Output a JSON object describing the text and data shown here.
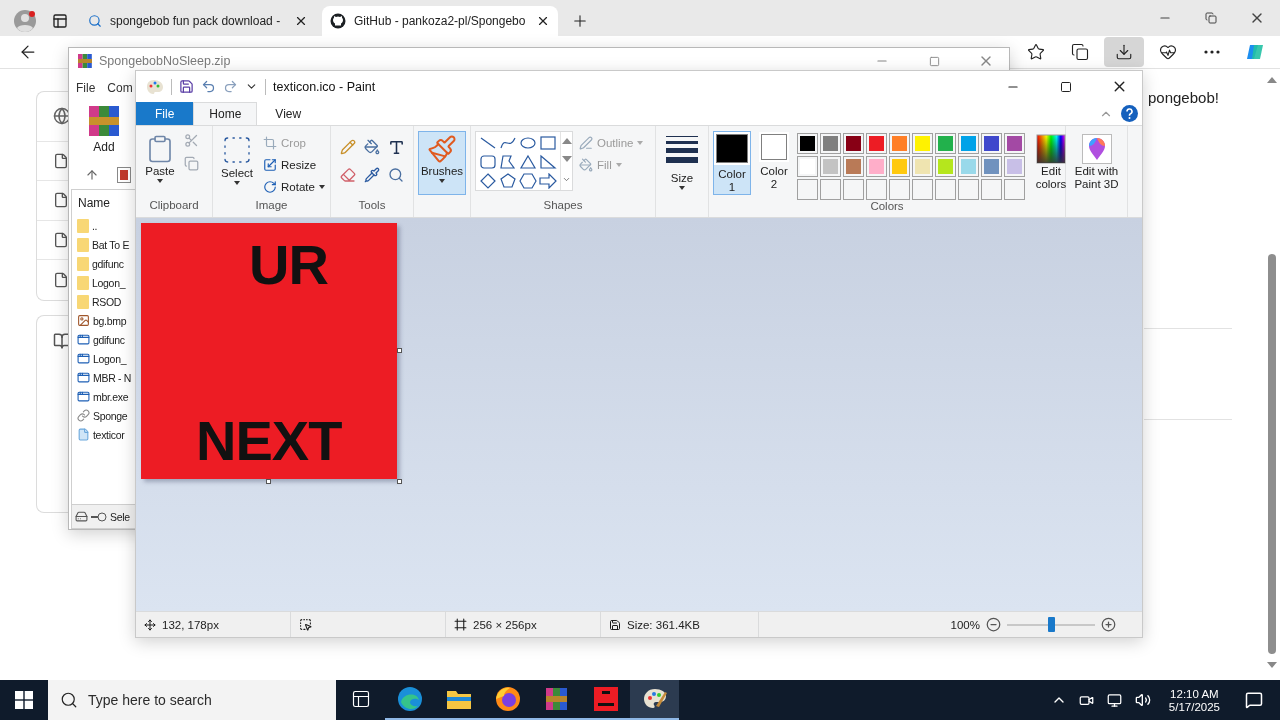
{
  "browser": {
    "tabs": [
      {
        "label": "spongebob fun pack download -",
        "kind": "search",
        "selected": false
      },
      {
        "label": "GitHub - pankoza2-pl/Spongebo",
        "kind": "github",
        "selected": true
      }
    ],
    "toolbar_buttons": [
      {
        "kind": "favorites",
        "selected": false
      },
      {
        "kind": "collections",
        "selected": false
      },
      {
        "kind": "downloads",
        "selected": true
      },
      {
        "kind": "health",
        "selected": false
      },
      {
        "kind": "more",
        "selected": false
      },
      {
        "kind": "copilot",
        "selected": false
      }
    ],
    "page_text": "pongebob!"
  },
  "archive_window": {
    "title": "SpongebobNoSleep.zip",
    "menu": [
      "File",
      "Com"
    ],
    "tool": "Add",
    "column": "Name",
    "files": [
      {
        "name": "..",
        "kind": "folder"
      },
      {
        "name": "Bat To E",
        "kind": "folder"
      },
      {
        "name": "gdifunc",
        "kind": "folder"
      },
      {
        "name": "Logon_",
        "kind": "folder"
      },
      {
        "name": "RSOD",
        "kind": "folder"
      },
      {
        "name": "bg.bmp",
        "kind": "image"
      },
      {
        "name": "gdifunc",
        "kind": "app"
      },
      {
        "name": "Logon_",
        "kind": "app"
      },
      {
        "name": "MBR - N",
        "kind": "app"
      },
      {
        "name": "mbr.exe",
        "kind": "app"
      },
      {
        "name": "Sponge",
        "kind": "link"
      },
      {
        "name": "texticor",
        "kind": "document"
      }
    ],
    "status": "Sele"
  },
  "paint": {
    "title": "texticon.ico - Paint",
    "ribbon_tabs": [
      {
        "label": "File",
        "kind": "file",
        "selected": false
      },
      {
        "label": "Home",
        "kind": "tab",
        "selected": true
      },
      {
        "label": "View",
        "kind": "tab",
        "selected": false
      }
    ],
    "clipboard": {
      "label": "Clipboard",
      "paste": "Paste"
    },
    "image": {
      "label": "Image",
      "select": "Select",
      "actions": [
        {
          "label": "Crop",
          "kind": "crop",
          "disabled": true
        },
        {
          "label": "Resize",
          "kind": "resize",
          "disabled": false
        },
        {
          "label": "Rotate",
          "kind": "rotate",
          "disabled": false
        }
      ]
    },
    "tools_label": "Tools",
    "brushes": {
      "label": "Brushes",
      "selected": true
    },
    "shapes": {
      "label": "Shapes",
      "outline": {
        "label": "Outline",
        "disabled": true
      },
      "fill": {
        "label": "Fill",
        "disabled": true
      }
    },
    "size_label": "Size",
    "colors": {
      "label": "Colors",
      "slots": [
        {
          "label": "Color 1",
          "color": "#000000",
          "selected": true
        },
        {
          "label": "Color 2",
          "color": "#ffffff",
          "selected": false
        }
      ],
      "palette": [
        {
          "kind": "swatch",
          "color": "#000000"
        },
        {
          "kind": "swatch",
          "color": "#7f7f7f"
        },
        {
          "kind": "swatch",
          "color": "#880015"
        },
        {
          "kind": "swatch",
          "color": "#ed1c24"
        },
        {
          "kind": "swatch",
          "color": "#ff7f27"
        },
        {
          "kind": "swatch",
          "color": "#fff200"
        },
        {
          "kind": "swatch",
          "color": "#22b14c"
        },
        {
          "kind": "swatch",
          "color": "#00a2e8"
        },
        {
          "kind": "swatch",
          "color": "#3f48cc"
        },
        {
          "kind": "swatch",
          "color": "#a349a4"
        },
        {
          "kind": "swatch",
          "color": "#ffffff"
        },
        {
          "kind": "swatch",
          "color": "#c3c3c3"
        },
        {
          "kind": "swatch",
          "color": "#b97a57"
        },
        {
          "kind": "swatch",
          "color": "#ffaec9"
        },
        {
          "kind": "swatch",
          "color": "#ffc90e"
        },
        {
          "kind": "swatch",
          "color": "#efe4b0"
        },
        {
          "kind": "swatch",
          "color": "#b5e61d"
        },
        {
          "kind": "swatch",
          "color": "#99d9ea"
        },
        {
          "kind": "swatch",
          "color": "#7092be"
        },
        {
          "kind": "swatch",
          "color": "#c8bfe7"
        },
        {
          "kind": "empty"
        },
        {
          "kind": "empty"
        },
        {
          "kind": "empty"
        },
        {
          "kind": "empty"
        },
        {
          "kind": "empty"
        },
        {
          "kind": "empty"
        },
        {
          "kind": "empty"
        },
        {
          "kind": "empty"
        },
        {
          "kind": "empty"
        },
        {
          "kind": "empty"
        }
      ],
      "edit": "Edit colors"
    },
    "paint3d": "Edit with Paint 3D",
    "canvas": {
      "lines": [
        "UR",
        "NEXT"
      ]
    },
    "status_bar": {
      "cursor": "132, 178px",
      "dimensions": "256 × 256px",
      "file_size": "Size: 361.4KB",
      "zoom": "100%",
      "zoom_slider": {
        "level": 0.5
      }
    }
  },
  "taskbar": {
    "search_placeholder": "Type here to search",
    "apps": [
      {
        "kind": "task-view",
        "selected": false
      },
      {
        "kind": "edge",
        "selected": false
      },
      {
        "kind": "explorer",
        "selected": false
      },
      {
        "kind": "firefox",
        "selected": false
      },
      {
        "kind": "archiver",
        "selected": false
      },
      {
        "kind": "red-image",
        "selected": false
      },
      {
        "kind": "paint",
        "selected": true
      }
    ],
    "time": "12:10 AM",
    "date": "5/17/2025"
  }
}
